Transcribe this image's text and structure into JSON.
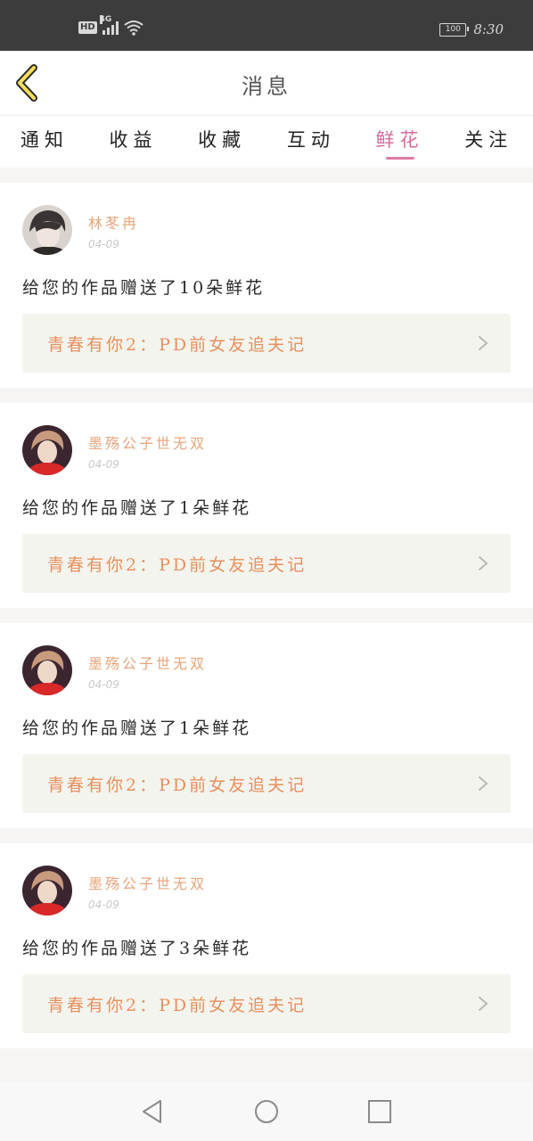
{
  "status_bar": {
    "hd": "HD",
    "network": "4G",
    "battery": "100",
    "time": "8:30"
  },
  "header": {
    "title": "消息"
  },
  "tabs": [
    {
      "label": "通知"
    },
    {
      "label": "收益"
    },
    {
      "label": "收藏"
    },
    {
      "label": "互动"
    },
    {
      "label": "鲜花"
    },
    {
      "label": "关注"
    }
  ],
  "active_tab": "鲜花",
  "colors": {
    "accent": "#e07aa8",
    "username": "#e9a57a",
    "work_title": "#e9905e",
    "card_bg": "#f4f4ee"
  },
  "messages": [
    {
      "user": "林苳冉",
      "date": "04-09",
      "text": "给您的作品赠送了10朵鲜花",
      "work": "青春有你2：PD前女友追夫记"
    },
    {
      "user": "墨殇公子世无双",
      "date": "04-09",
      "text": "给您的作品赠送了1朵鲜花",
      "work": "青春有你2：PD前女友追夫记"
    },
    {
      "user": "墨殇公子世无双",
      "date": "04-09",
      "text": "给您的作品赠送了1朵鲜花",
      "work": "青春有你2：PD前女友追夫记"
    },
    {
      "user": "墨殇公子世无双",
      "date": "04-09",
      "text": "给您的作品赠送了3朵鲜花",
      "work": "青春有你2：PD前女友追夫记"
    }
  ],
  "icons": {
    "back": "back-chevron-icon",
    "nav": [
      "nav-back-icon",
      "nav-home-icon",
      "nav-recent-icon"
    ]
  }
}
